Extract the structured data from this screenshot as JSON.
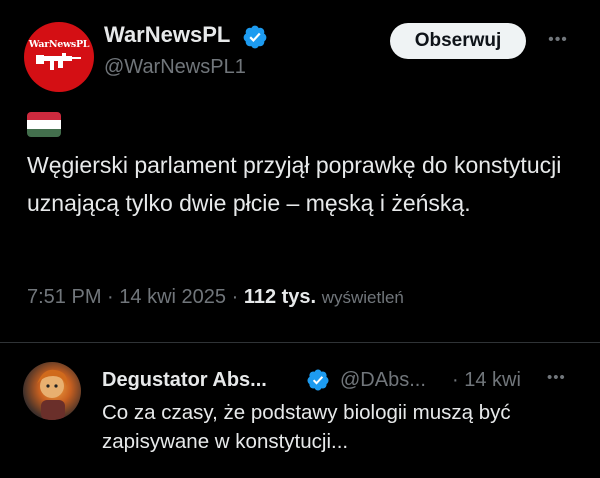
{
  "post": {
    "author_name": "WarNewsPL",
    "handle": "@WarNewsPL1",
    "avatar_logo_text": "WarNewsPL",
    "follow_label": "Obserwuj",
    "more_label": "•••",
    "flag_colors": [
      "#cd2a3e",
      "#ffffff",
      "#436f4d"
    ],
    "text": "Węgierski parlament przyjął poprawkę do konstytucji uznającą tylko dwie płcie – męską i żeńską.",
    "time": "7:51 PM",
    "separator": "·",
    "date": "14 kwi 2025",
    "views_count": "112 tys.",
    "views_label": "wyświetleń",
    "verified_color": "#1d9bf0"
  },
  "reply": {
    "author_name": "Degustator Abs...",
    "handle": "@DAbs...",
    "time": "· 14 kwi",
    "more_label": "•••",
    "text": "Co za czasy, że podstawy biologii muszą być zapisywane w konstytucji..."
  }
}
